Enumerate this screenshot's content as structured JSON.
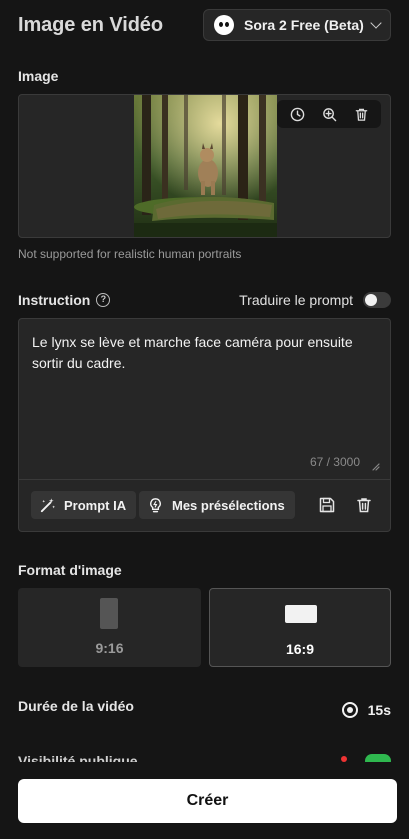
{
  "header": {
    "title": "Image en Vidéo",
    "model_label": "Sora 2 Free (Beta)"
  },
  "image_section": {
    "label": "Image",
    "note": "Not supported for realistic human portraits",
    "tools": [
      "history-icon",
      "zoom-in-icon",
      "trash-icon"
    ]
  },
  "instruction": {
    "label": "Instruction",
    "help_glyph": "?",
    "translate_label": "Traduire le prompt",
    "translate_on": false,
    "text": "Le lynx se lève et marche face caméra pour ensuite sortir du cadre.",
    "counter": "67 / 3000",
    "prompt_ai_label": "Prompt IA",
    "presets_label": "Mes présélections"
  },
  "format": {
    "label": "Format d'image",
    "options": [
      {
        "label": "9:16",
        "selected": false,
        "text_color": "#9a9a9a"
      },
      {
        "label": "16:9",
        "selected": true,
        "text_color": "#ffffff"
      }
    ]
  },
  "duration": {
    "label": "Durée de la vidéo",
    "value": "15s"
  },
  "cutoff_row": {
    "label": "Visibilité publique"
  },
  "create_button": "Créer",
  "colors": {
    "background": "#151515",
    "panel": "#262626",
    "toggle_on": "#2fb84f"
  }
}
